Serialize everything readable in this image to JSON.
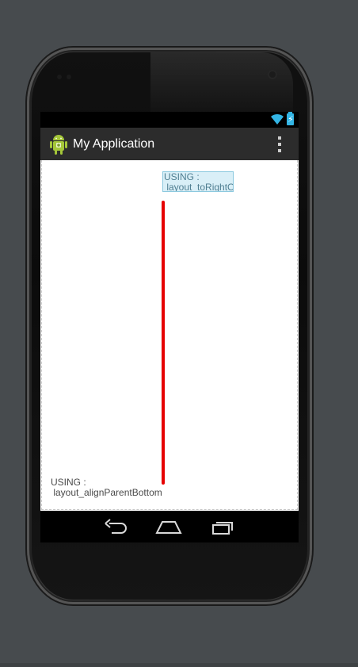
{
  "app": {
    "title": "My Application",
    "icon": "android-robot-icon"
  },
  "status_bar": {
    "icons": [
      "wifi-icon",
      "battery-charging-icon"
    ],
    "accent_color": "#33b5e5"
  },
  "content": {
    "right_label": "USING :\n layout_toRightOf",
    "bottom_label": "USING :\n layout_alignParentBottom",
    "divider_color": "#e60000"
  },
  "navigation": {
    "buttons": [
      "back-icon",
      "home-icon",
      "recent-apps-icon"
    ]
  }
}
